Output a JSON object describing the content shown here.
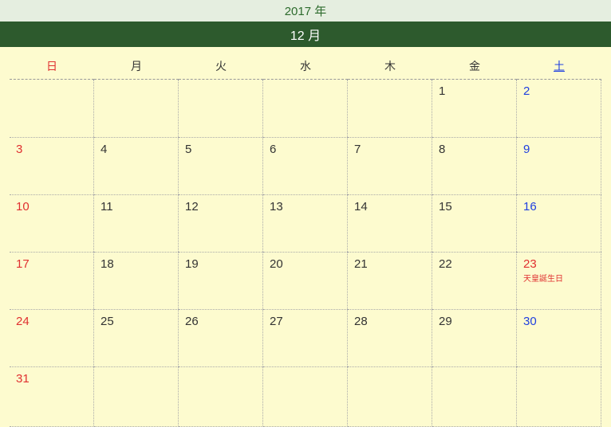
{
  "year_label": "2017 年",
  "month_label": "12 月",
  "day_headers": [
    "日",
    "月",
    "火",
    "水",
    "木",
    "金",
    "土"
  ],
  "weeks": [
    [
      null,
      null,
      null,
      null,
      null,
      {
        "n": "1"
      },
      {
        "n": "2",
        "sat": true
      }
    ],
    [
      {
        "n": "3",
        "sun": true
      },
      {
        "n": "4"
      },
      {
        "n": "5"
      },
      {
        "n": "6"
      },
      {
        "n": "7"
      },
      {
        "n": "8"
      },
      {
        "n": "9",
        "sat": true
      }
    ],
    [
      {
        "n": "10",
        "sun": true
      },
      {
        "n": "11"
      },
      {
        "n": "12"
      },
      {
        "n": "13"
      },
      {
        "n": "14"
      },
      {
        "n": "15"
      },
      {
        "n": "16",
        "sat": true
      }
    ],
    [
      {
        "n": "17",
        "sun": true
      },
      {
        "n": "18"
      },
      {
        "n": "19"
      },
      {
        "n": "20"
      },
      {
        "n": "21"
      },
      {
        "n": "22"
      },
      {
        "n": "23",
        "holiday": true,
        "label": "天皇誕生日"
      }
    ],
    [
      {
        "n": "24",
        "sun": true
      },
      {
        "n": "25"
      },
      {
        "n": "26"
      },
      {
        "n": "27"
      },
      {
        "n": "28"
      },
      {
        "n": "29"
      },
      {
        "n": "30",
        "sat": true
      }
    ],
    [
      {
        "n": "31",
        "sun": true
      },
      null,
      null,
      null,
      null,
      null,
      null
    ]
  ]
}
